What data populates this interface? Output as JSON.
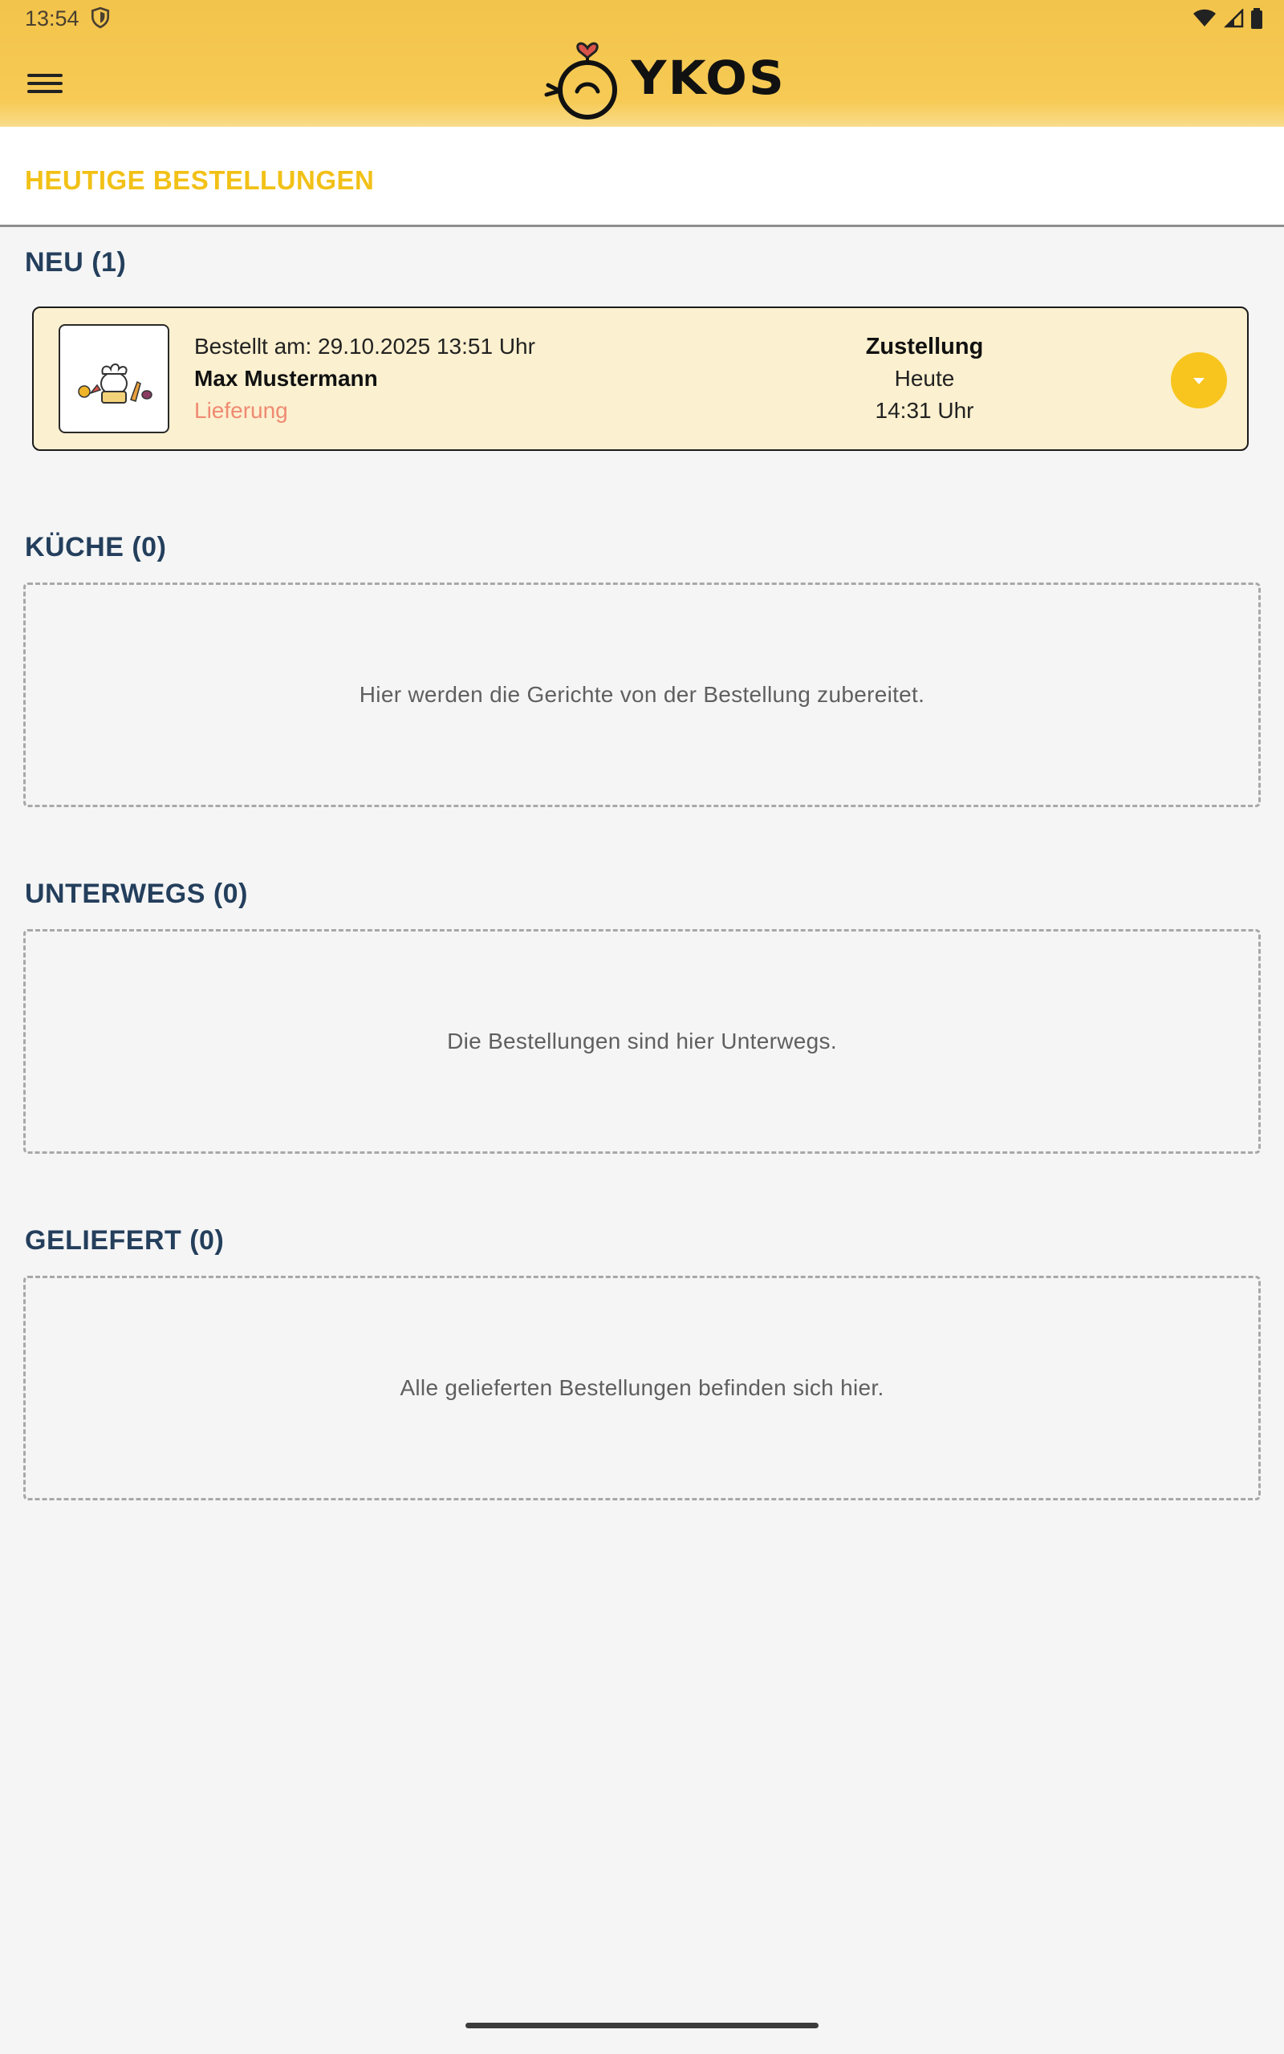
{
  "status_bar": {
    "time": "13:54"
  },
  "app": {
    "logo_text": "YKOS"
  },
  "page": {
    "title": "HEUTIGE BESTELLUNGEN"
  },
  "sections": {
    "neu": {
      "label": "NEU (1)"
    },
    "kueche": {
      "label": "KÜCHE (0)",
      "empty_text": "Hier werden die Gerichte von der Bestellung zubereitet."
    },
    "unterwegs": {
      "label": "UNTERWEGS (0)",
      "empty_text": "Die Bestellungen sind hier Unterwegs."
    },
    "geliefert": {
      "label": "GELIEFERT (0)",
      "empty_text": "Alle gelieferten Bestellungen befinden sich hier."
    }
  },
  "order": {
    "ordered_at": "Bestellt am: 29.10.2025   13:51 Uhr",
    "customer": "Max Mustermann",
    "type": "Lieferung",
    "delivery_title": "Zustellung",
    "delivery_day": "Heute",
    "delivery_time": "14:31 Uhr"
  },
  "colors": {
    "appbar": "#f6ca55",
    "title_accent": "#f2c117",
    "section_label": "#243f5c",
    "card_bg": "#fbf0cf",
    "order_type": "#ef8a72",
    "expand_button": "#f7c51e"
  },
  "icons": [
    "menu-icon",
    "shield-icon",
    "wifi-icon",
    "signal-icon",
    "battery-icon",
    "chef-food-icon",
    "chevron-down-icon"
  ]
}
